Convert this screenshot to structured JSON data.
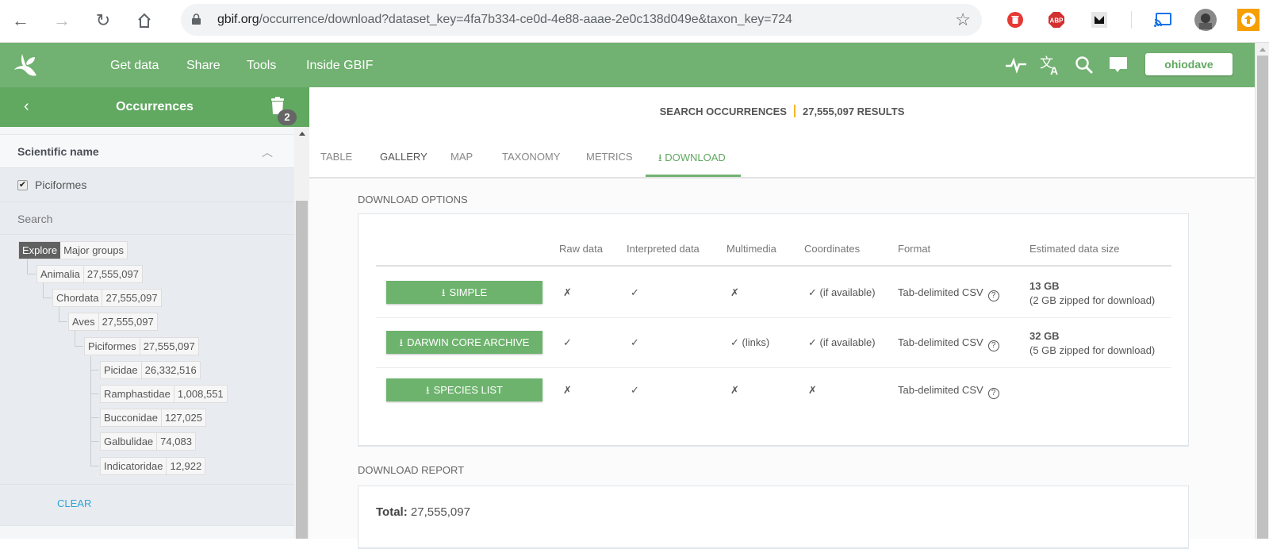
{
  "browser": {
    "url_host": "gbif.org",
    "url_path": "/occurrence/download?dataset_key=4fa7b334-ce0d-4e88-aaae-2e0c138d049e&taxon_key=724",
    "extensions": [
      "trash-extension-icon",
      "adblock-plus-icon",
      "medium-icon",
      "cast-icon",
      "profile-avatar",
      "update-icon"
    ],
    "abp_label": "ABP"
  },
  "topnav": {
    "links": [
      "Get data",
      "Share",
      "Tools",
      "Inside GBIF"
    ],
    "user_label": "ohiodave"
  },
  "sidebar": {
    "title": "Occurrences",
    "filter_count": "2",
    "facet_title": "Scientific name",
    "selected_value": "Piciformes",
    "search_placeholder": "Search",
    "toggle": {
      "active": "Explore",
      "inactive": "Major groups"
    },
    "tree": [
      {
        "name": "Animalia",
        "count": "27,555,097",
        "level": 0
      },
      {
        "name": "Chordata",
        "count": "27,555,097",
        "level": 1
      },
      {
        "name": "Aves",
        "count": "27,555,097",
        "level": 2
      },
      {
        "name": "Piciformes",
        "count": "27,555,097",
        "level": 3
      },
      {
        "name": "Picidae",
        "count": "26,332,516",
        "level": 4
      },
      {
        "name": "Ramphastidae",
        "count": "1,008,551",
        "level": 4
      },
      {
        "name": "Bucconidae",
        "count": "127,025",
        "level": 4
      },
      {
        "name": "Galbulidae",
        "count": "74,083",
        "level": 4
      },
      {
        "name": "Indicatoridae",
        "count": "12,922",
        "level": 4
      }
    ],
    "clear_label": "CLEAR"
  },
  "main": {
    "title": "SEARCH OCCURRENCES",
    "results": "27,555,097 RESULTS",
    "tabs": [
      "TABLE",
      "GALLERY",
      "MAP",
      "TAXONOMY",
      "METRICS",
      "DOWNLOAD"
    ],
    "active_tab": "DOWNLOAD",
    "options_label": "DOWNLOAD OPTIONS",
    "columns": [
      "Raw data",
      "Interpreted data",
      "Multimedia",
      "Coordinates",
      "Format",
      "Estimated data size"
    ],
    "rows": [
      {
        "button": "SIMPLE",
        "raw": "✗",
        "interpreted": "✓",
        "multimedia": "✗",
        "coordinates": "✓ (if available)",
        "format": "Tab-delimited CSV",
        "size": "13 GB",
        "size_note": "(2 GB zipped for download)"
      },
      {
        "button": "DARWIN CORE ARCHIVE",
        "raw": "✓",
        "interpreted": "✓",
        "multimedia": "✓ (links)",
        "coordinates": "✓ (if available)",
        "format": "Tab-delimited CSV",
        "size": "32 GB",
        "size_note": "(5 GB zipped for download)"
      },
      {
        "button": "SPECIES LIST",
        "raw": "✗",
        "interpreted": "✓",
        "multimedia": "✗",
        "coordinates": "✗",
        "format": "Tab-delimited CSV",
        "size": "",
        "size_note": ""
      }
    ],
    "report_label": "DOWNLOAD REPORT",
    "total_label": "Total:",
    "total_value": "27,555,097"
  },
  "colors": {
    "brand_green": "#71b171",
    "button_green": "#6db36d",
    "accent_orange": "#f5b624",
    "link_blue": "#2ea4d4"
  }
}
